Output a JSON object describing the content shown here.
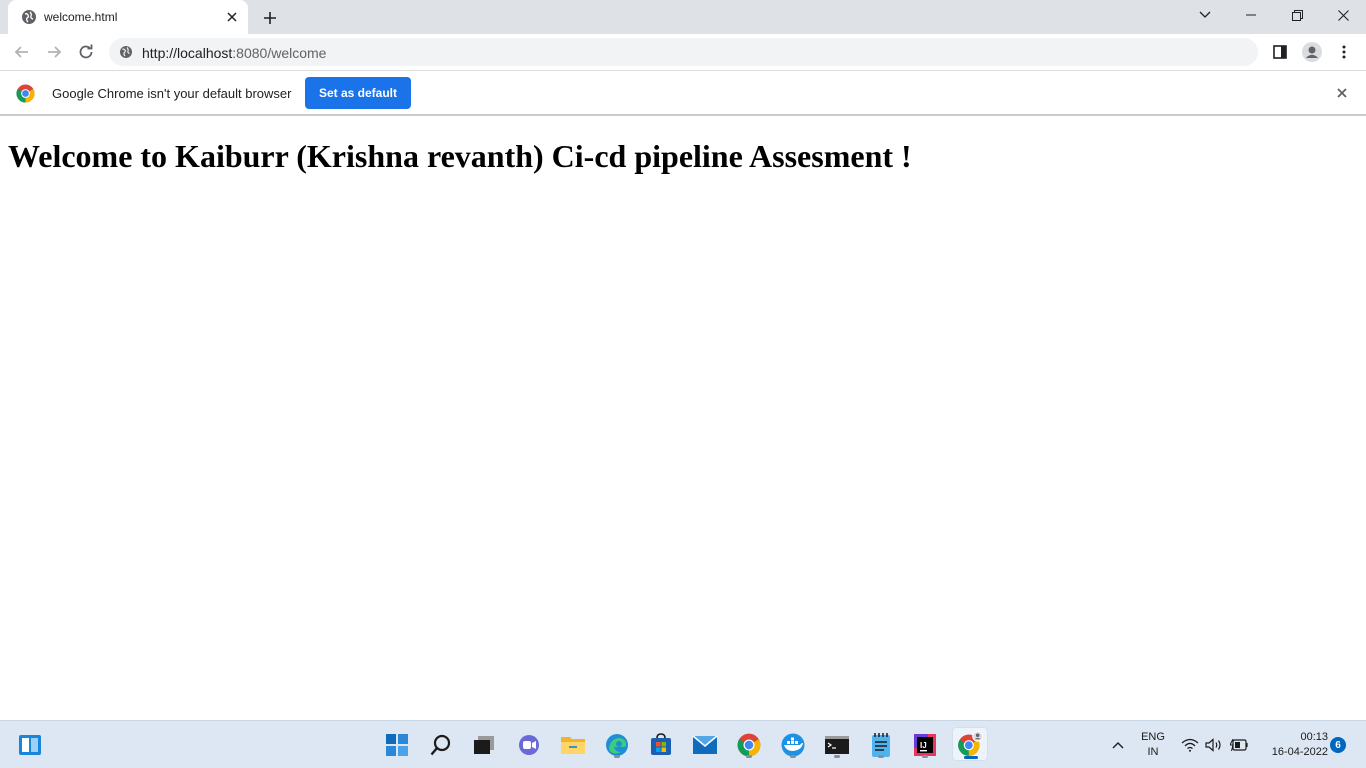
{
  "browser": {
    "tab": {
      "title": "welcome.html"
    },
    "address_bar": {
      "url_host": "http://localhost",
      "url_rest": ":8080/welcome"
    },
    "infobar": {
      "message": "Google Chrome isn't your default browser",
      "button_label": "Set as default"
    }
  },
  "page": {
    "heading": "Welcome to Kaiburr (Krishna revanth) Ci-cd pipeline Assesment !"
  },
  "taskbar": {
    "apps": [
      "start-icon",
      "search-icon",
      "task-view-icon",
      "chat-icon",
      "file-explorer-icon",
      "edge-icon",
      "store-icon",
      "mail-icon",
      "chrome-icon",
      "docker-icon",
      "terminal-icon",
      "notepad-icon",
      "intellij-icon",
      "chrome-profile-icon"
    ],
    "tray": {
      "language": "ENG",
      "region": "IN",
      "time": "00:13",
      "date": "16-04-2022",
      "notification_count": "6"
    }
  },
  "colors": {
    "accent": "#1a73e8",
    "taskbar": "#dce7f3",
    "tabstrip": "#dee1e6"
  }
}
